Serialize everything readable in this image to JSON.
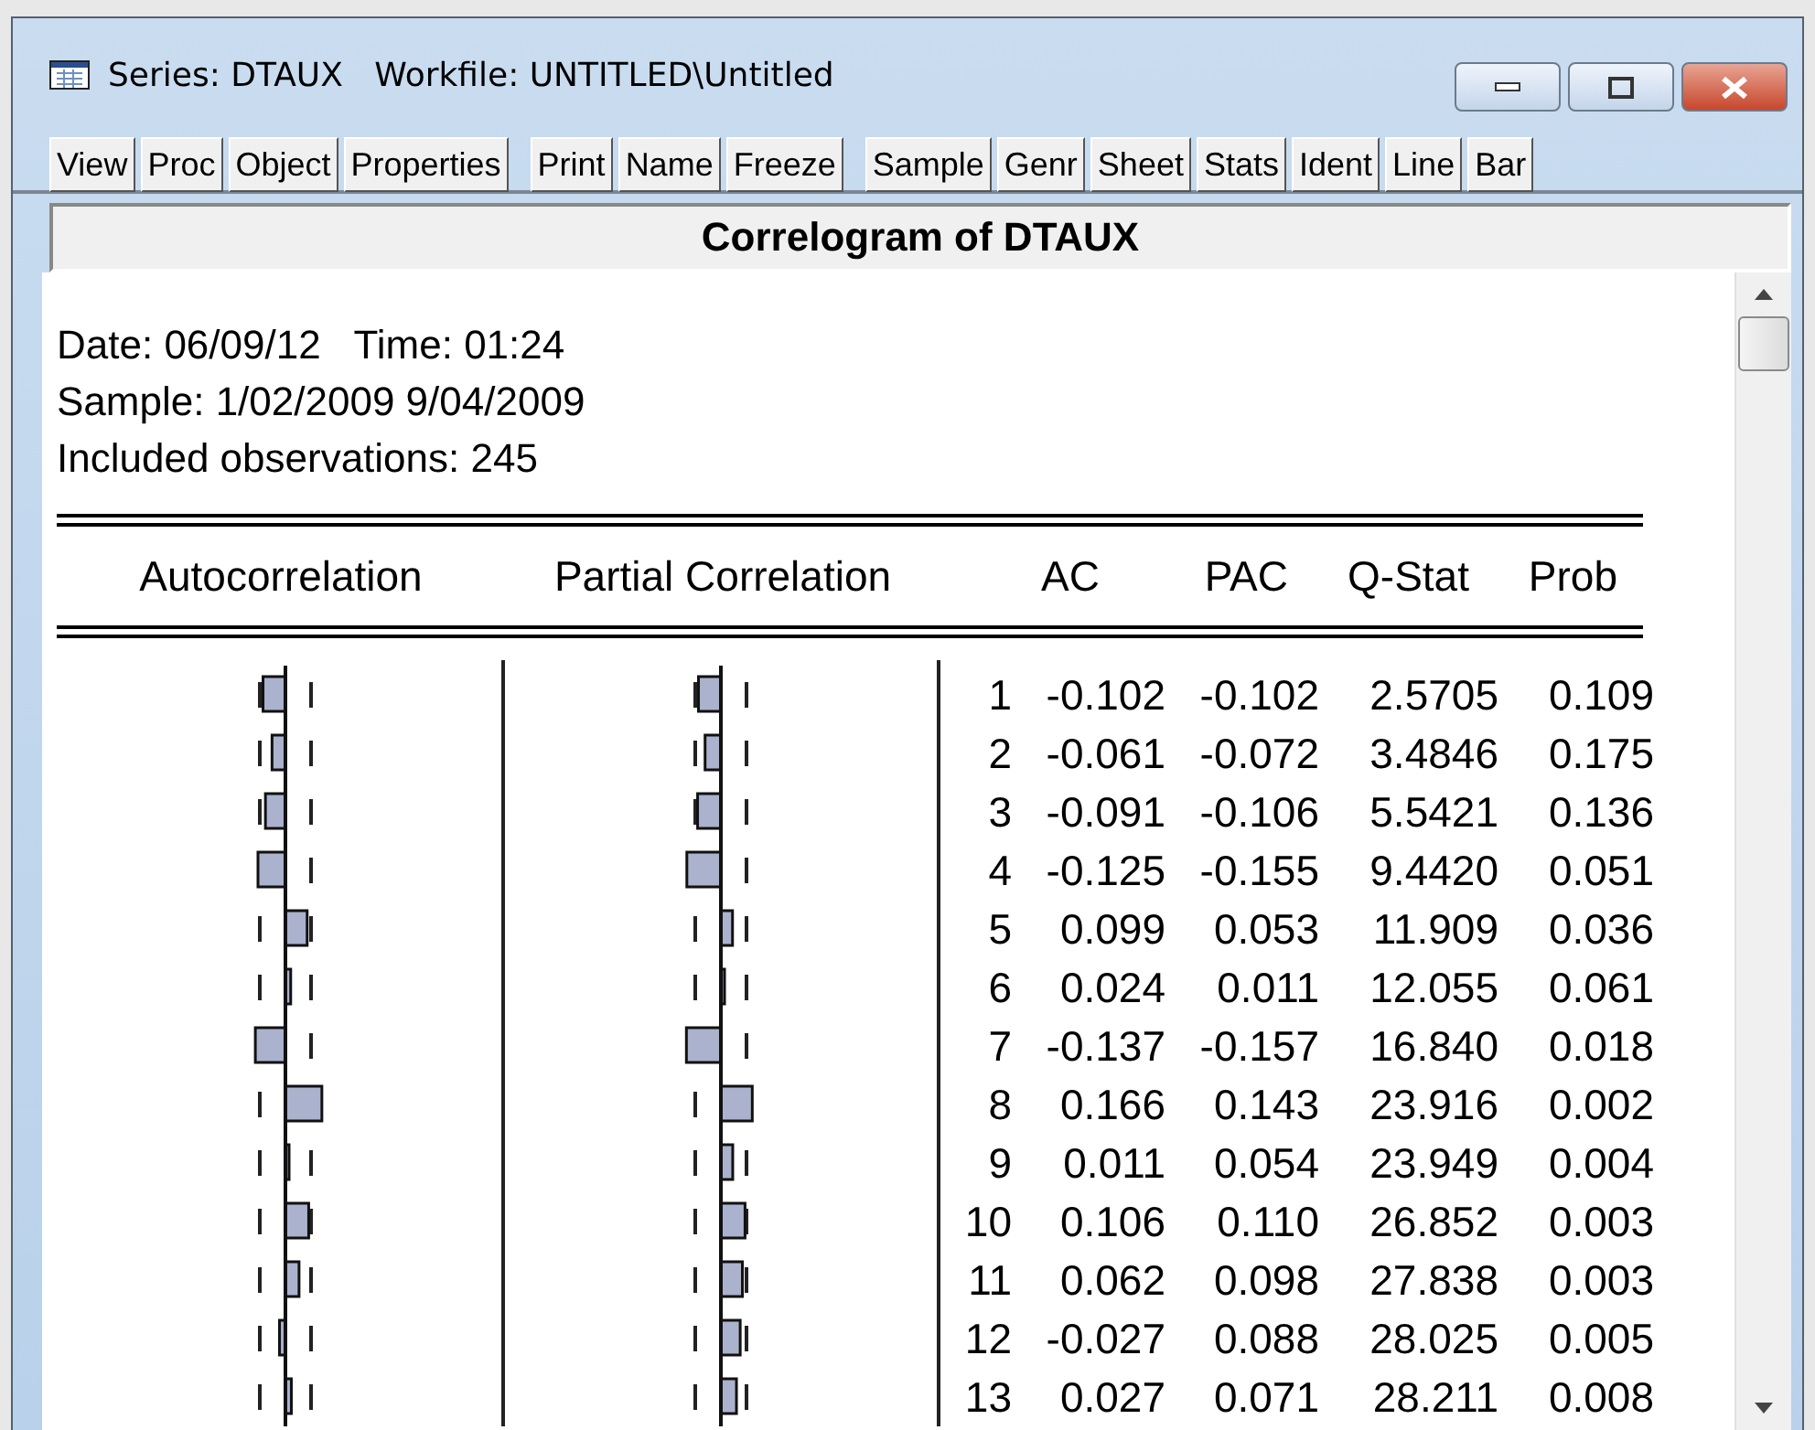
{
  "window": {
    "title": "Series: DTAUX   Workfile: UNTITLED\\Untitled"
  },
  "toolbar": [
    [
      "View",
      "Proc",
      "Object",
      "Properties"
    ],
    [
      "Print",
      "Name",
      "Freeze"
    ],
    [
      "Sample",
      "Genr",
      "Sheet",
      "Stats",
      "Ident",
      "Line",
      "Bar"
    ]
  ],
  "view_title": "Correlogram of DTAUX",
  "info_lines": [
    "Date: 06/09/12   Time: 01:24",
    "Sample: 1/02/2009 9/04/2009",
    "Included observations: 245"
  ],
  "columns": [
    "Autocorrelation",
    "Partial Correlation",
    "AC",
    "PAC",
    "Q-Stat",
    "Prob"
  ],
  "rows": [
    {
      "lag": "1",
      "ac": "-0.102",
      "pac": "-0.102",
      "q_stat": "2.5705",
      "prob": "0.109"
    },
    {
      "lag": "2",
      "ac": "-0.061",
      "pac": "-0.072",
      "q_stat": "3.4846",
      "prob": "0.175"
    },
    {
      "lag": "3",
      "ac": "-0.091",
      "pac": "-0.106",
      "q_stat": "5.5421",
      "prob": "0.136"
    },
    {
      "lag": "4",
      "ac": "-0.125",
      "pac": "-0.155",
      "q_stat": "9.4420",
      "prob": "0.051"
    },
    {
      "lag": "5",
      "ac": "0.099",
      "pac": "0.053",
      "q_stat": "11.909",
      "prob": "0.036"
    },
    {
      "lag": "6",
      "ac": "0.024",
      "pac": "0.011",
      "q_stat": "12.055",
      "prob": "0.061"
    },
    {
      "lag": "7",
      "ac": "-0.137",
      "pac": "-0.157",
      "q_stat": "16.840",
      "prob": "0.018"
    },
    {
      "lag": "8",
      "ac": "0.166",
      "pac": "0.143",
      "q_stat": "23.916",
      "prob": "0.002"
    },
    {
      "lag": "9",
      "ac": "0.011",
      "pac": "0.054",
      "q_stat": "23.949",
      "prob": "0.004"
    },
    {
      "lag": "10",
      "ac": "0.106",
      "pac": "0.110",
      "q_stat": "26.852",
      "prob": "0.003"
    },
    {
      "lag": "11",
      "ac": "0.062",
      "pac": "0.098",
      "q_stat": "27.838",
      "prob": "0.003"
    },
    {
      "lag": "12",
      "ac": "-0.027",
      "pac": "0.088",
      "q_stat": "28.025",
      "prob": "0.005"
    },
    {
      "lag": "13",
      "ac": "0.027",
      "pac": "0.071",
      "q_stat": "28.211",
      "prob": "0.008"
    }
  ]
}
